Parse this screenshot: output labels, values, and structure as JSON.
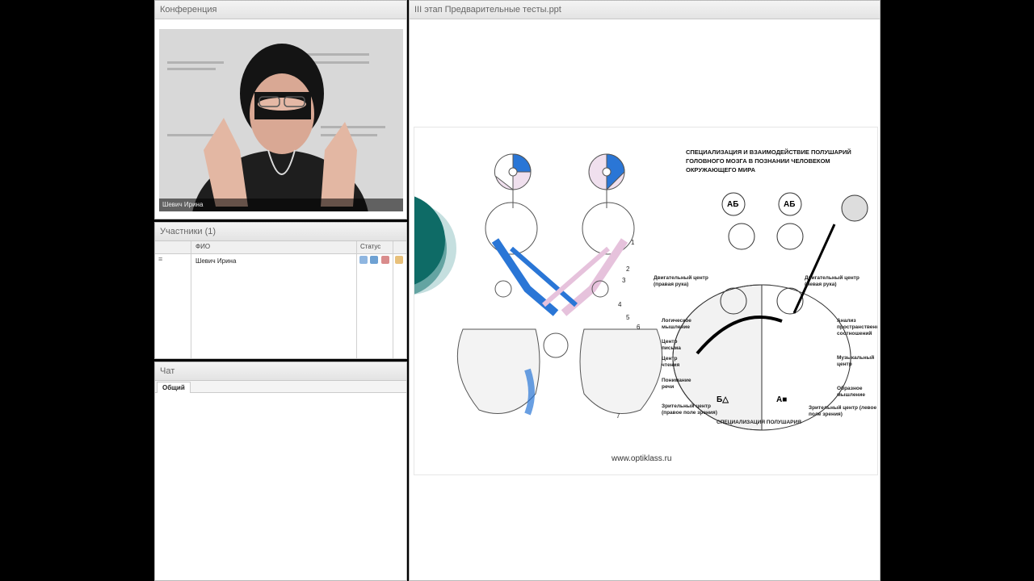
{
  "conference": {
    "title": "Конференция",
    "video_name": "Шевич Ирина"
  },
  "participants": {
    "title": "Участники (1)",
    "columns": [
      "ФИО",
      "Статус"
    ],
    "rows": [
      {
        "name": "Шевич Ирина"
      }
    ]
  },
  "chat": {
    "title": "Чат",
    "tabs": [
      "Общий"
    ]
  },
  "presentation": {
    "title": "III этап  Предварительные тесты.ppt",
    "url": "www.optiklass.ru",
    "slide_title": "СПЕЦИАЛИЗАЦИЯ И ВЗАИМОДЕЙСТВИЕ ПОЛУШАРИЙ ГОЛОВНОГО МОЗГА В ПОЗНАНИИ ЧЕЛОВЕКОМ ОКРУЖАЮЩЕГО МИРА",
    "slide_footer": "СПЕЦИАЛИЗАЦИЯ ПОЛУШАРИЯ",
    "labels": {
      "motor_right": "Двигательный центр (правая рука)",
      "motor_left": "Двигательный центр (левая рука)",
      "logic": "Логическое мышление",
      "writing": "Центр письма",
      "reading": "Центр чтения",
      "speech": "Понимание речи",
      "visual_right": "Зрительный центр (правое поле зрения)",
      "spatial": "Анализ пространственных соотношений",
      "music": "Музыкальный центр",
      "imagery": "Образное мышление",
      "visual_left": "Зрительный центр (левое поле зрения)"
    },
    "numbers": [
      "1",
      "2",
      "3",
      "4",
      "5",
      "6",
      "7"
    ]
  }
}
